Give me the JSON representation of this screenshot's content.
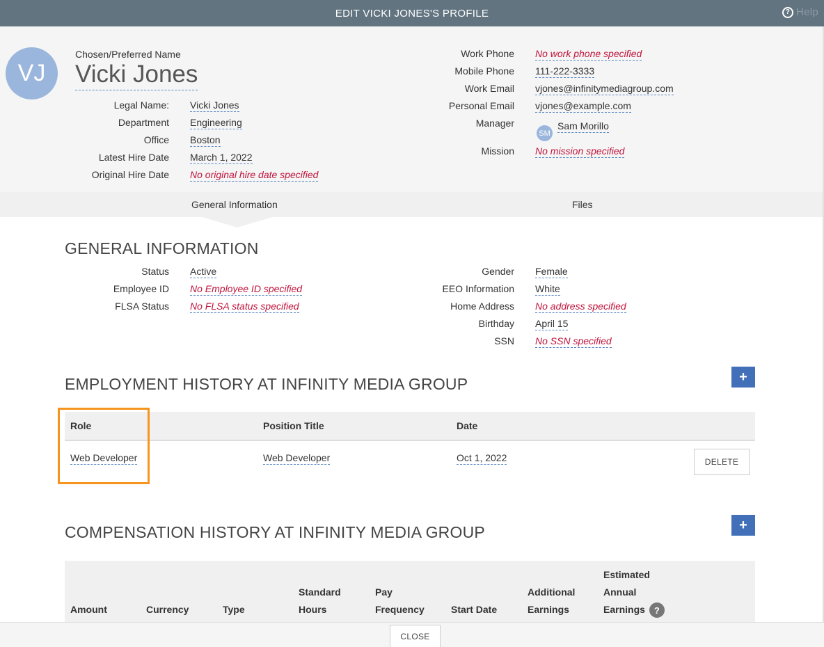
{
  "title": "EDIT VICKI JONES'S PROFILE",
  "help_label": "Help",
  "header": {
    "avatar_initials": "VJ",
    "pref_label": "Chosen/Preferred Name",
    "name": "Vicki Jones",
    "left_fields": [
      {
        "label": "Legal Name:",
        "value": "Vicki Jones"
      },
      {
        "label": "Department",
        "value": "Engineering"
      },
      {
        "label": "Office",
        "value": "Boston"
      },
      {
        "label": "Latest Hire Date",
        "value": "March 1, 2022"
      },
      {
        "label": "Original Hire Date",
        "value": "No original hire date specified"
      }
    ],
    "right_fields": [
      {
        "label": "Work Phone",
        "value": "No work phone specified"
      },
      {
        "label": "Mobile Phone",
        "value": "111-222-3333"
      },
      {
        "label": "Work Email",
        "value": "vjones@infinitymediagroup.com"
      },
      {
        "label": "Personal Email",
        "value": "vjones@example.com"
      },
      {
        "label": "Manager",
        "value": "Sam Morillo",
        "avatar": "SM"
      },
      {
        "label": "Mission",
        "value": "No mission specified"
      }
    ]
  },
  "tabs": [
    "General Information",
    "Files"
  ],
  "general": {
    "title": "GENERAL INFORMATION",
    "left": [
      {
        "label": "Status",
        "value": "Active"
      },
      {
        "label": "Employee ID",
        "value": "No Employee ID specified"
      },
      {
        "label": "FLSA Status",
        "value": "No FLSA status specified"
      }
    ],
    "right": [
      {
        "label": "Gender",
        "value": "Female"
      },
      {
        "label": "EEO Information",
        "value": "White"
      },
      {
        "label": "Home Address",
        "value": "No address specified"
      },
      {
        "label": "Birthday",
        "value": "April 15"
      },
      {
        "label": "SSN",
        "value": "No SSN specified"
      }
    ]
  },
  "employment": {
    "title": "EMPLOYMENT HISTORY AT INFINITY MEDIA GROUP",
    "add_label": "+",
    "columns": [
      "Role",
      "Position Title",
      "Date"
    ],
    "rows": [
      {
        "role": "Web Developer",
        "position": "Web Developer",
        "date": "Oct 1, 2022",
        "delete_label": "DELETE"
      }
    ]
  },
  "compensation": {
    "title": "COMPENSATION HISTORY AT INFINITY MEDIA GROUP",
    "add_label": "+",
    "columns": [
      {
        "l1": "",
        "l2": "",
        "l3": "Amount"
      },
      {
        "l1": "",
        "l2": "",
        "l3": "Currency"
      },
      {
        "l1": "",
        "l2": "",
        "l3": "Type"
      },
      {
        "l1": "",
        "l2": "Standard",
        "l3": "Hours"
      },
      {
        "l1": "",
        "l2": "Pay",
        "l3": "Frequency"
      },
      {
        "l1": "",
        "l2": "",
        "l3": "Start Date"
      },
      {
        "l1": "",
        "l2": "Additional",
        "l3": "Earnings"
      },
      {
        "l1": "Estimated",
        "l2": "Annual",
        "l3": "Earnings"
      }
    ],
    "info_icon": "?"
  },
  "close_label": "CLOSE"
}
